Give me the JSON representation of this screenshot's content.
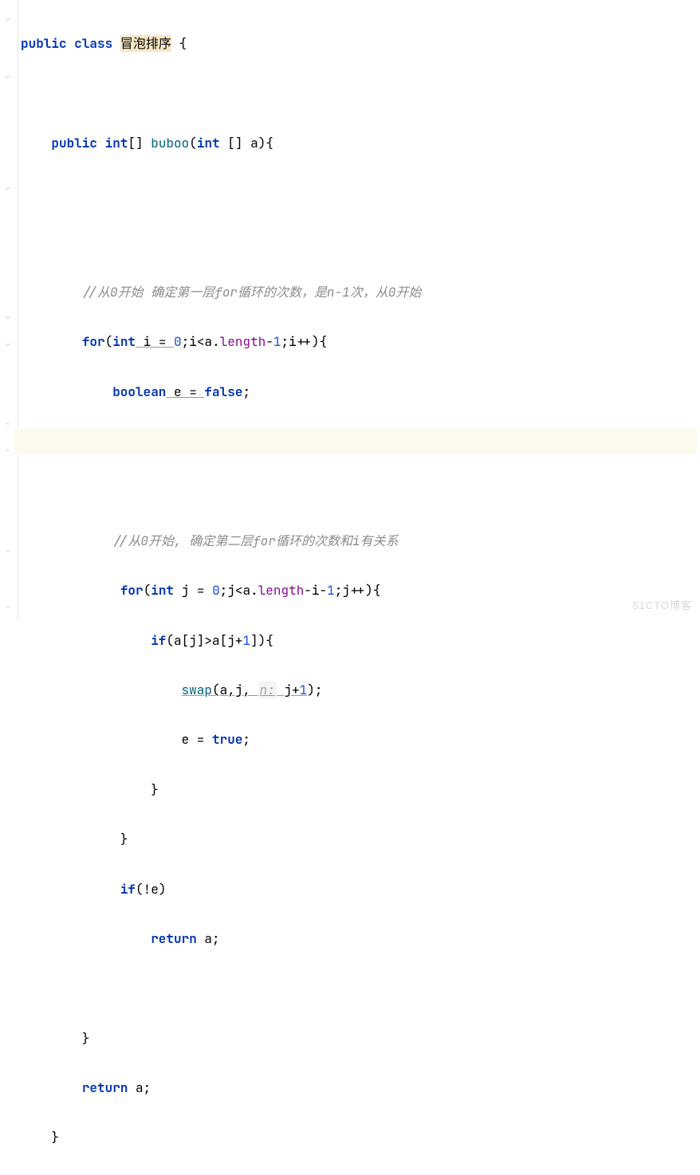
{
  "code": {
    "l1_kw1": "public",
    "l1_kw2": "class",
    "l1_name": "冒泡排序",
    "l1_brace": " {",
    "l2_kw1": "public",
    "l2_kw2": "int",
    "l2_arr": "[] ",
    "l2_method": "buboo",
    "l2_params_open": "(",
    "l2_params_kw": "int",
    "l2_params_rest": " [] a){",
    "l3_comment": "//从0开始 确定第一层for循环的次数，是n-1次，从0开始",
    "l4_kw": "for",
    "l4_open": "(",
    "l4_int": "int",
    "l4_var": " i = ",
    "l4_zero": "0",
    "l4_mid": ";i<a.",
    "l4_len": "length",
    "l4_rest": "-",
    "l4_one": "1",
    "l4_end": ";i++){",
    "l5_kw": "boolean",
    "l5_rest": " e = ",
    "l5_false": "false",
    "l5_semi": ";",
    "l7_comment": "//从0开始, 确定第二层for循环的次数和i有关系",
    "l8_kw": "for",
    "l8_open": "(",
    "l8_int": "int",
    "l8_var": " j = ",
    "l8_zero": "0",
    "l8_mid": ";j<a.",
    "l8_len": "length",
    "l8_rest1": "-i-",
    "l8_one": "1",
    "l8_rest2": ";j++){",
    "l9_kw": "if",
    "l9_cond1": "(a[j]>a[j+",
    "l9_one": "1",
    "l9_cond2": "]){",
    "l10_swap": "swap",
    "l10_args1": "(a,j, ",
    "l10_hint": "n:",
    "l10_args2": " j+",
    "l10_one": "1",
    "l10_close": ");",
    "l11_e": "e = ",
    "l11_true": "true",
    "l11_semi": ";",
    "l12_brace": "}",
    "l13_brace": "}",
    "l14_kw": "if",
    "l14_cond": "(!e)",
    "l15_kw": "return",
    "l15_rest": " a;",
    "l16_brace": "}",
    "l17_kw": "return",
    "l17_rest": " a;",
    "l18_brace": "}"
  },
  "watermark": "51CTO博客"
}
